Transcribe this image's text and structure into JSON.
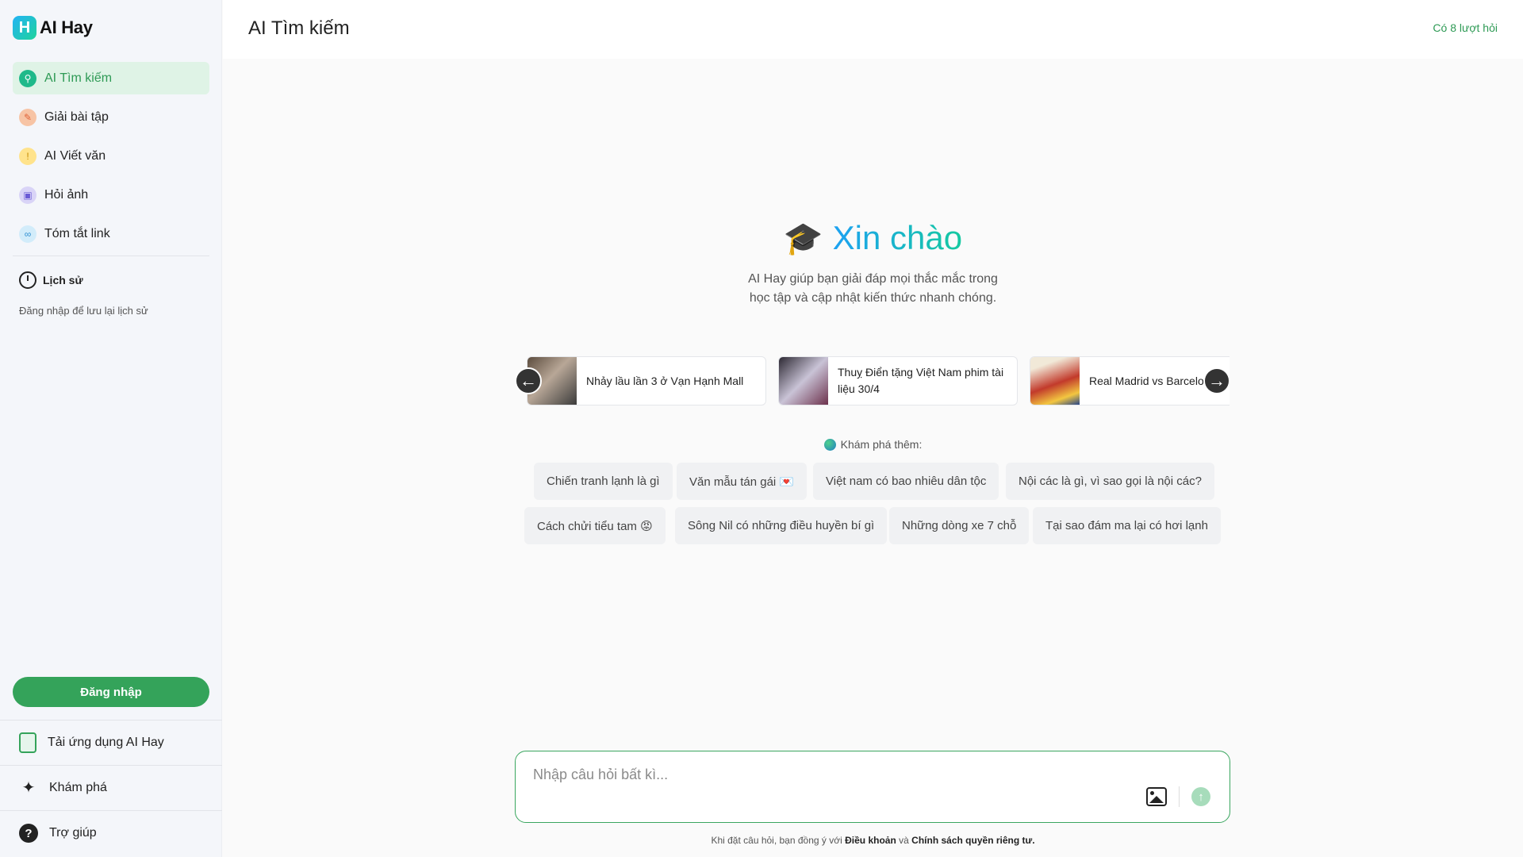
{
  "app": {
    "logo_letter": "H",
    "name": "AI Hay"
  },
  "sidebar": {
    "items": [
      {
        "label": "AI Tìm kiếm",
        "icon": "search-icon",
        "active": true
      },
      {
        "label": "Giải bài tập",
        "icon": "homework-icon"
      },
      {
        "label": "AI Viết văn",
        "icon": "writing-icon"
      },
      {
        "label": "Hỏi ảnh",
        "icon": "photo-icon"
      },
      {
        "label": "Tóm tắt link",
        "icon": "link-icon"
      }
    ],
    "history_title": "Lịch sử",
    "history_note": "Đăng nhập để lưu lại lịch sử",
    "login_label": "Đăng nhập",
    "bottom": {
      "download": "Tải ứng dụng AI Hay",
      "explore": "Khám phá",
      "help": "Trợ giúp"
    }
  },
  "header": {
    "title": "AI Tìm kiếm",
    "quota": "Có 8 lượt hỏi"
  },
  "hero": {
    "greeting": "Xin chào",
    "subtitle": "AI Hay giúp bạn giải đáp mọi thắc mắc trong học tập và cập nhật kiến thức nhanh chóng."
  },
  "trending": [
    {
      "title": "Nhảy lầu lần 3 ở Vạn Hạnh Mall"
    },
    {
      "title": "Thuỵ Điển tặng Việt Nam phim tài liệu 30/4"
    },
    {
      "title": "Real Madrid vs Barcelona"
    }
  ],
  "explore": {
    "label": "Khám phá thêm:",
    "chips": [
      "Chiến tranh lạnh là gì",
      "Văn mẫu tán gái 💌",
      "Việt nam có bao nhiêu dân tộc",
      "Nội các là gì, vì sao gọi là nội các?",
      "Cách chửi tiểu tam 😡",
      "Sông Nil có những điều huyền bí gì",
      "Những dòng xe 7 chỗ",
      "Tại sao đám ma lại có hơi lạnh"
    ]
  },
  "input": {
    "placeholder": "Nhập câu hỏi bất kì..."
  },
  "terms": {
    "prefix": "Khi đặt câu hỏi, bạn đồng ý với",
    "terms_link": "Điều khoản",
    "and": "và",
    "privacy_link": "Chính sách quyền riêng tư."
  },
  "colors": {
    "accent": "#34a35a",
    "active_bg": "#dff3e6",
    "greeting_from": "#1da1f2",
    "greeting_to": "#15c9a0"
  }
}
